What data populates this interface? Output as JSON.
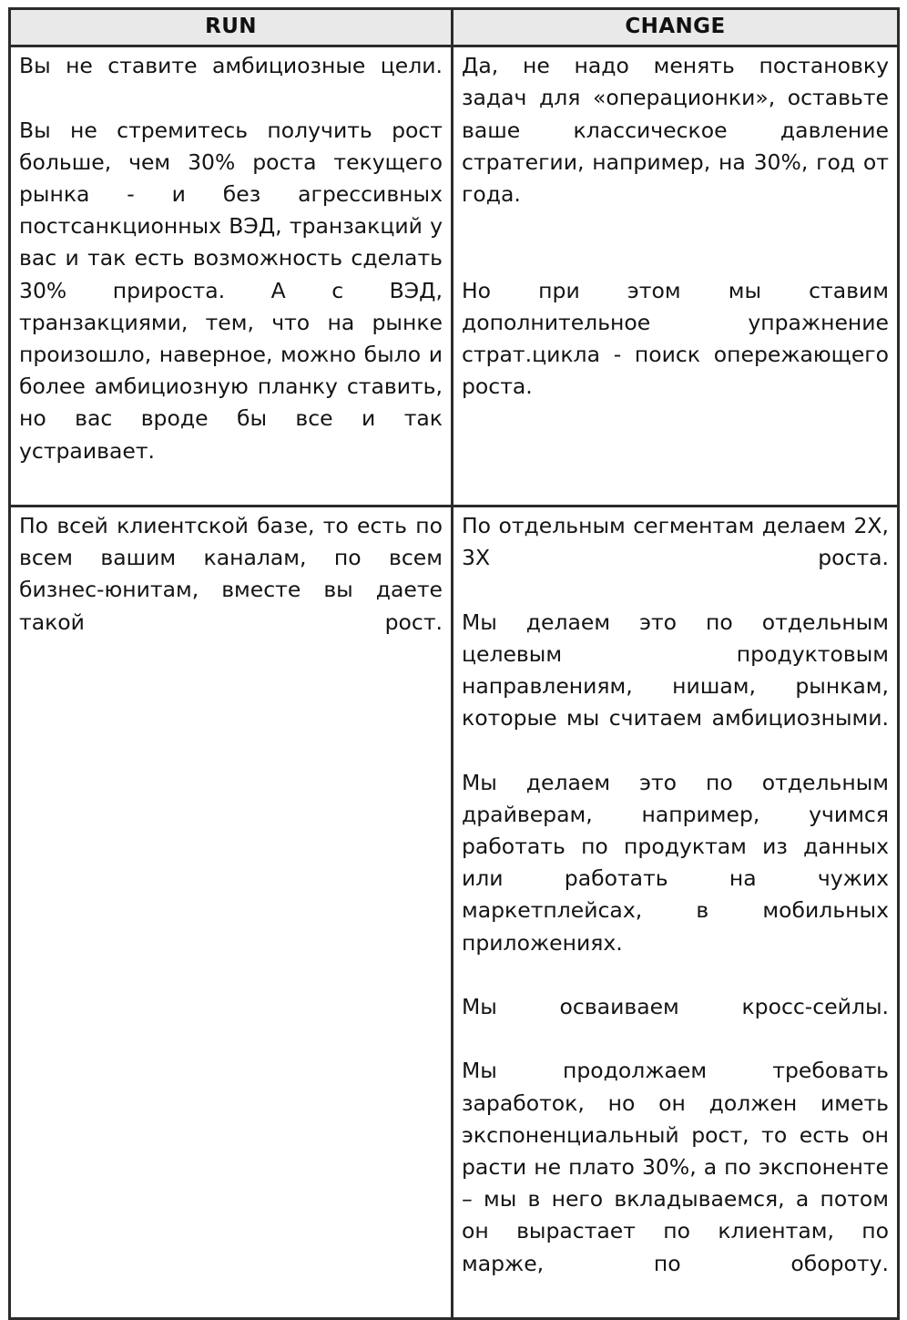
{
  "document": {
    "type": "two-column-comparison-table",
    "background_color": "#ffffff",
    "border_color": "#2b2b2b",
    "header_fill_color": "#e9e9e9",
    "text_color": "#141414"
  },
  "table": {
    "columns": [
      {
        "key": "run",
        "header": "RUN"
      },
      {
        "key": "change",
        "header": "CHANGE"
      }
    ],
    "rows": [
      {
        "run": {
          "paragraphs": [
            "Вы не ставите амбициозные цели.",
            "Вы не стремитесь получить рост больше, чем 30% роста текущего рынка - и без агрессивных постсанкционных ВЭД, транзакций у вас и так есть возможность сделать 30% прироста. А с ВЭД, транзакциями, тем, что на рынке произошло, наверное, можно было и более амбициозную планку ставить, но вас вроде бы все и так устраивает."
          ]
        },
        "change": {
          "paragraphs": [
            "Да, не надо менять постановку задач для «операционки», оставьте ваше классическое давление стратегии, например, на 30%, год от года.",
            "Но при этом мы ставим дополнительное упражнение страт.цикла - поиск опережающего роста."
          ],
          "blank_line_after_paragraph_index": 0
        }
      },
      {
        "run": {
          "paragraphs": [
            "По всей клиентской базе, то есть по всем вашим каналам, по всем бизнес-юнитам, вместе вы даете такой рост."
          ]
        },
        "change": {
          "paragraphs": [
            "По отдельным сегментам делаем 2Х, 3Х роста.",
            "Мы делаем это по отдельным целевым продуктовым направлениям, нишам, рынкам, которые мы считаем амбициозными.",
            "Мы делаем это по отдельным драйверам, например, учимся работать по продуктам из данных или работать на чужих маркетплейсах, в мобильных приложениях.",
            "Мы осваиваем кросс-сейлы.",
            "Мы продолжаем требовать заработок, но он должен иметь экспоненциальный рост, то есть он расти не плато 30%, а по экспоненте – мы в него вкладываемся, а потом он вырастает по клиентам, по марже, по обороту."
          ]
        }
      }
    ]
  }
}
